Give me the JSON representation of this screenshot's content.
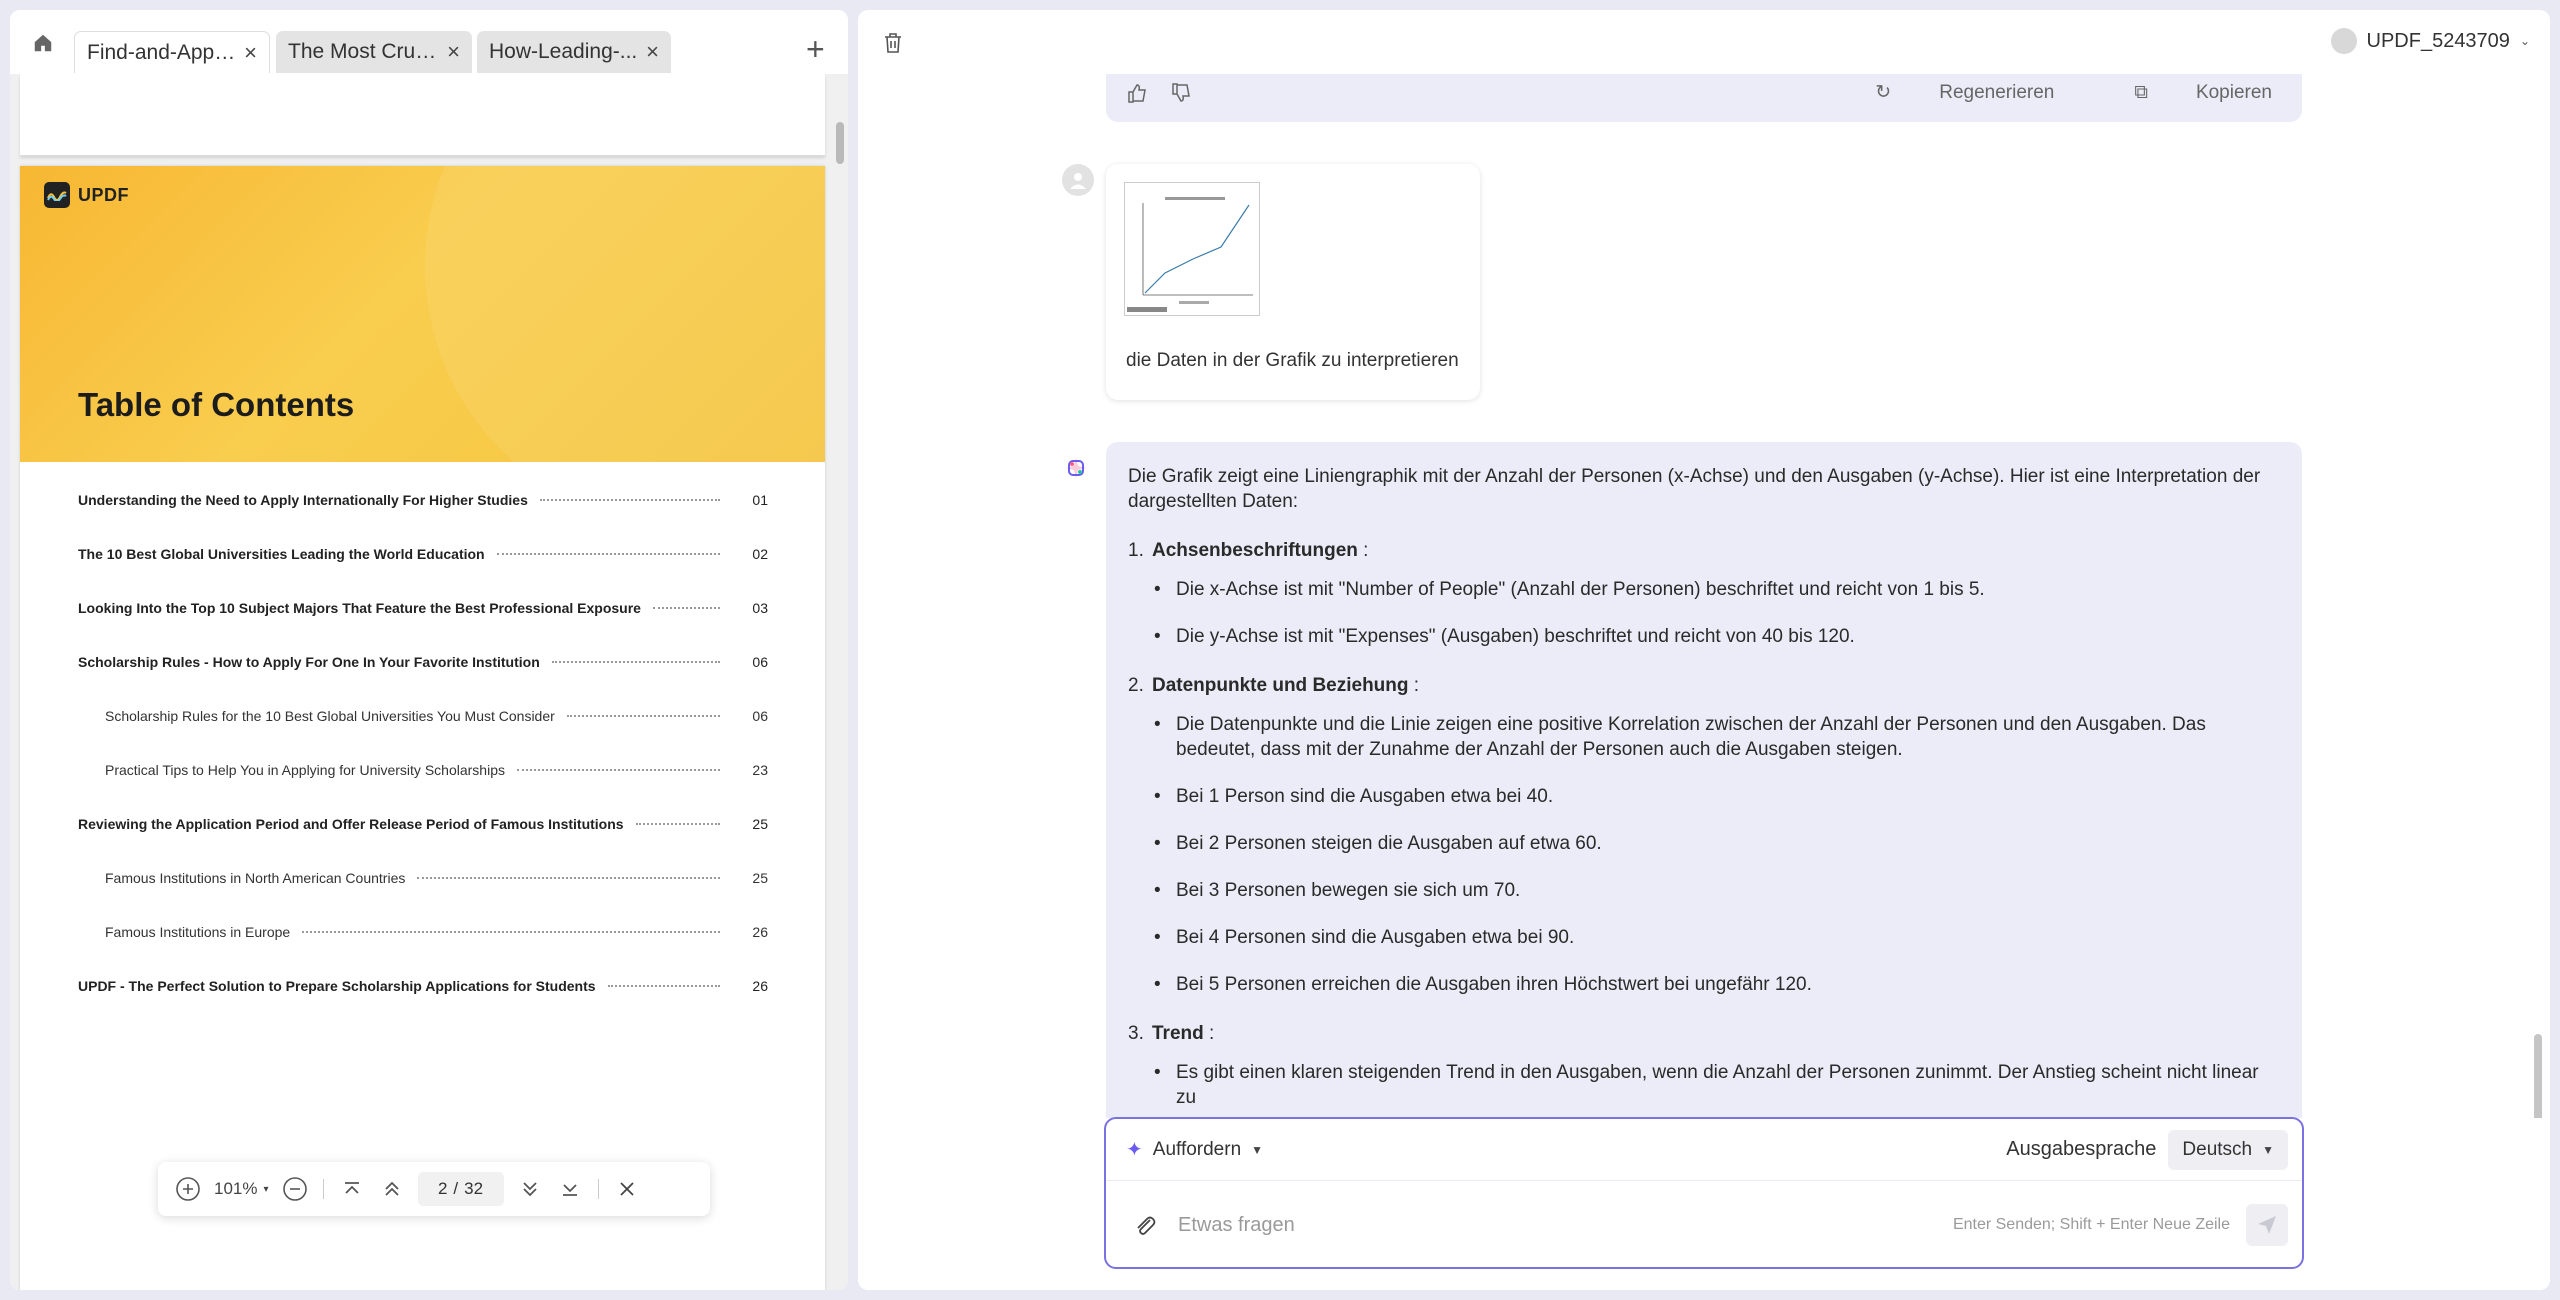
{
  "tabs": [
    {
      "label": "Find-and-Appl..."
    },
    {
      "label": "The Most Cruci..."
    },
    {
      "label": "How-Leading-..."
    }
  ],
  "document": {
    "logo_text": "UPDF",
    "toc_title": "Table of Contents",
    "toc": [
      {
        "text": "Understanding the Need to Apply Internationally For Higher Studies",
        "page": "01",
        "level": 1
      },
      {
        "text": "The 10 Best Global Universities Leading the World Education",
        "page": "02",
        "level": 1
      },
      {
        "text": "Looking Into the Top 10 Subject Majors That Feature the Best Professional Exposure",
        "page": "03",
        "level": 1
      },
      {
        "text": "Scholarship Rules - How to Apply For One In Your Favorite Institution",
        "page": "06",
        "level": 1
      },
      {
        "text": "Scholarship Rules for the 10 Best Global Universities You Must Consider",
        "page": "06",
        "level": 2
      },
      {
        "text": "Practical Tips to Help You in Applying for University Scholarships",
        "page": "23",
        "level": 2
      },
      {
        "text": "Reviewing the Application Period and Offer Release Period of Famous Institutions",
        "page": "25",
        "level": 1
      },
      {
        "text": "Famous Institutions in North American Countries",
        "page": "25",
        "level": 2
      },
      {
        "text": "Famous Institutions in Europe",
        "page": "26",
        "level": 2
      },
      {
        "text": "UPDF - The Perfect Solution to Prepare Scholarship Applications for Students",
        "page": "26",
        "level": 1
      }
    ]
  },
  "page_toolbar": {
    "zoom": "101%",
    "current_page": "2",
    "separator": "/",
    "total_pages": "32"
  },
  "header": {
    "username": "UPDF_5243709"
  },
  "chat": {
    "prev_actions": {
      "regenerate": "Regenerieren",
      "copy": "Kopieren"
    },
    "user_message": "die Daten in der Grafik zu interpretieren",
    "ai": {
      "intro": "Die Grafik zeigt eine Liniengraphik mit der Anzahl der Personen (x-Achse) und den Ausgaben (y-Achse). Hier ist eine Interpretation der dargestellten Daten:",
      "sections": [
        {
          "num": "1.",
          "title": "Achsenbeschriftungen",
          "suffix": " :",
          "bullets": [
            "Die x-Achse ist mit \"Number of People\" (Anzahl der Personen) beschriftet und reicht von 1 bis 5.",
            "Die y-Achse ist mit \"Expenses\" (Ausgaben) beschriftet und reicht von 40 bis 120."
          ]
        },
        {
          "num": "2.",
          "title": "Datenpunkte und Beziehung",
          "suffix": " :",
          "bullets": [
            "Die Datenpunkte und die Linie zeigen eine positive Korrelation zwischen der Anzahl der Personen und den Ausgaben. Das bedeutet, dass mit der Zunahme der Anzahl der Personen auch die Ausgaben steigen.",
            "Bei 1 Person sind die Ausgaben etwa bei 40.",
            "Bei 2 Personen steigen die Ausgaben auf etwa 60.",
            "Bei 3 Personen bewegen sie sich um 70.",
            "Bei 4 Personen sind die Ausgaben etwa bei 90.",
            "Bei 5 Personen erreichen die Ausgaben ihren Höchstwert bei ungefähr 120."
          ]
        },
        {
          "num": "3.",
          "title": "Trend",
          "suffix": " :",
          "bullets": [
            "Es gibt einen klaren steigenden Trend in den Ausgaben, wenn die Anzahl der Personen zunimmt. Der Anstieg scheint nicht linear zu"
          ]
        }
      ]
    }
  },
  "composer": {
    "prompt_mode": "Auffordern",
    "language_label": "Ausgabesprache",
    "language_value": "Deutsch",
    "placeholder": "Etwas fragen",
    "hint": "Enter Senden; Shift + Enter Neue Zeile"
  },
  "colors": {
    "accent": "#7a72e0",
    "ai_bubble": "#ececf8",
    "doc_header": "#f7c33e"
  }
}
